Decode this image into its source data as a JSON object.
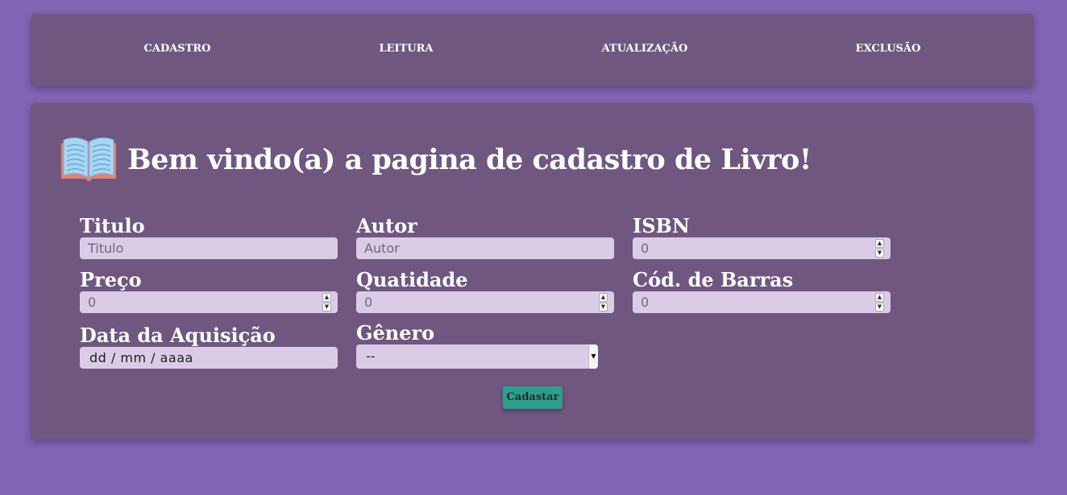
{
  "nav": {
    "items": [
      {
        "label": "CADASTRO"
      },
      {
        "label": "LEITURA"
      },
      {
        "label": "ATUALIZAÇÃO"
      },
      {
        "label": "EXCLUSÃO"
      }
    ]
  },
  "main": {
    "heading": "Bem vindo(a) a pagina de cadastro de Livro!",
    "heading_icon": "open-book-icon",
    "fields": {
      "titulo": {
        "label": "Titulo",
        "placeholder": "Titulo",
        "value": ""
      },
      "autor": {
        "label": "Autor",
        "placeholder": "Autor",
        "value": ""
      },
      "isbn": {
        "label": "ISBN",
        "value": "0"
      },
      "preco": {
        "label": "Preço",
        "value": "0"
      },
      "quantidade": {
        "label": "Quatidade",
        "value": "0"
      },
      "cod_barras": {
        "label": "Cód. de Barras",
        "value": "0"
      },
      "data_aquisicao": {
        "label": "Data da Aquisição",
        "value": "dd / mm / aaaa"
      },
      "genero": {
        "label": "Gênero",
        "selected": "--"
      }
    },
    "submit_label": "Cadastar"
  },
  "colors": {
    "background": "#8164b4",
    "panel": "#705780",
    "input": "#dccbe7",
    "button": "#2e9f8c"
  }
}
